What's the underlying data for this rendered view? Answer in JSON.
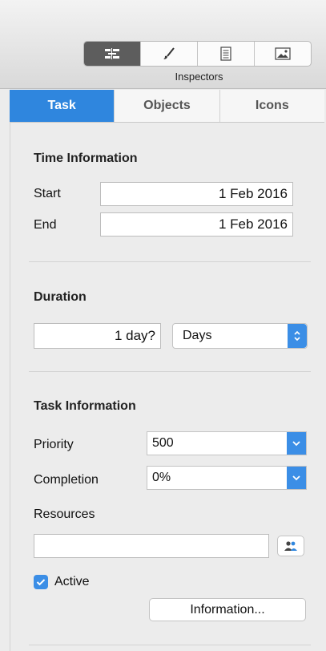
{
  "header": {
    "caption": "Inspectors",
    "tools": [
      {
        "icon": "task-inspector-icon",
        "active": true
      },
      {
        "icon": "style-brush-icon",
        "active": false
      },
      {
        "icon": "document-icon",
        "active": false
      },
      {
        "icon": "image-icon",
        "active": false
      }
    ]
  },
  "tabs": [
    "Task",
    "Objects",
    "Icons"
  ],
  "active_tab": "Task",
  "time": {
    "title": "Time Information",
    "start_label": "Start",
    "start_value": "1 Feb 2016",
    "end_label": "End",
    "end_value": "1 Feb 2016"
  },
  "duration": {
    "title": "Duration",
    "value": "1 day?",
    "unit": "Days"
  },
  "task_info": {
    "title": "Task Information",
    "priority_label": "Priority",
    "priority_value": "500",
    "completion_label": "Completion",
    "completion_value": "0%",
    "resources_label": "Resources",
    "resources_value": "",
    "active_label": "Active",
    "active_checked": true,
    "info_button": "Information..."
  },
  "colors": {
    "accent": "#2f86de",
    "control_blue": "#3b8ee6"
  }
}
